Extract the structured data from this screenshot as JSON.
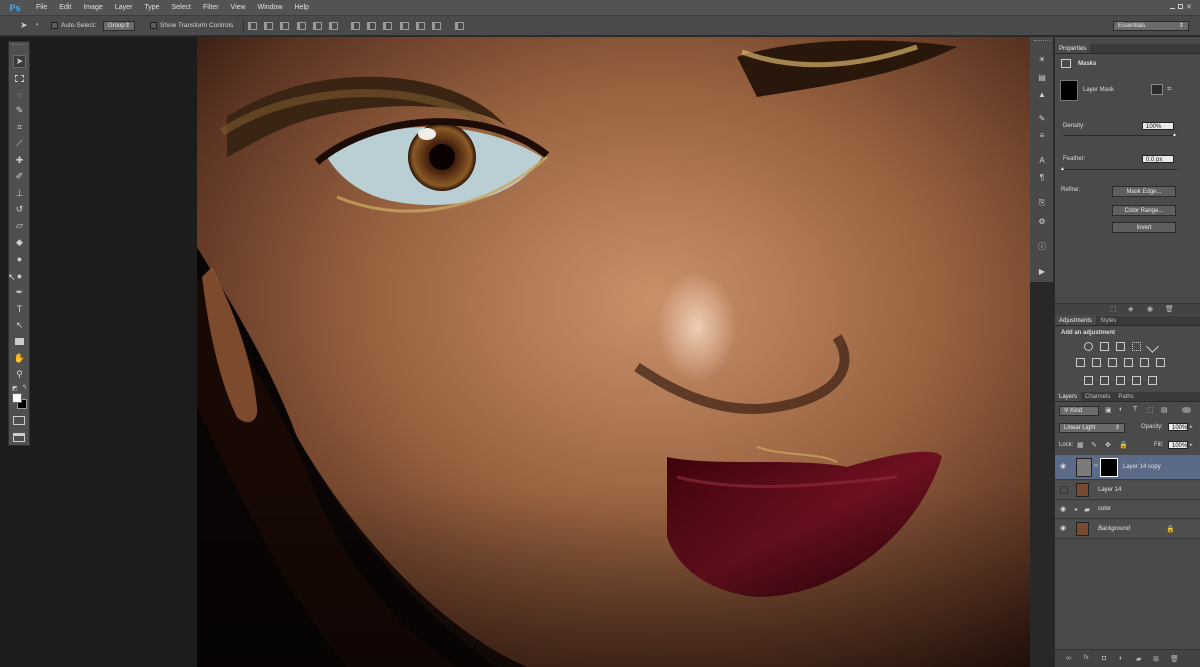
{
  "app": {
    "logo": "Ps"
  },
  "menu": [
    "File",
    "Edit",
    "Image",
    "Layer",
    "Type",
    "Select",
    "Filter",
    "View",
    "Window",
    "Help"
  ],
  "options": {
    "auto_select_label": "Auto-Select:",
    "auto_select_value": "Group",
    "transform_label": "Show Transform Controls",
    "workspace": "Essentials"
  },
  "properties": {
    "tab": "Properties",
    "section": "Masks",
    "mask_label": "Layer Mask",
    "density_label": "Density:",
    "density_value": "100%",
    "feather_label": "Feather:",
    "feather_value": "0.0 px",
    "refine_label": "Refine:",
    "mask_edge_button": "Mask Edge...",
    "color_range_button": "Color Range...",
    "invert_button": "Invert"
  },
  "adjustments": {
    "tabs": [
      "Adjustments",
      "Styles"
    ],
    "heading": "Add an adjustment"
  },
  "layers_panel": {
    "tabs": [
      "Layers",
      "Channels",
      "Paths"
    ],
    "filter_kind": "Kind",
    "blend_mode": "Linear Light",
    "opacity_label": "Opacity:",
    "opacity_value": "100%",
    "lock_label": "Lock:",
    "fill_label": "Fill:",
    "fill_value": "100%",
    "layers": [
      {
        "name": "Layer 14 copy",
        "visible": true,
        "selected": true
      },
      {
        "name": "Layer 14",
        "visible": false,
        "selected": false
      },
      {
        "name": "color",
        "visible": true,
        "selected": false
      },
      {
        "name": "Background",
        "visible": true,
        "selected": false
      }
    ]
  },
  "colors": {
    "accent": "#4aa7ea",
    "selection": "#5a6a87",
    "lip": "#5a0a14"
  }
}
